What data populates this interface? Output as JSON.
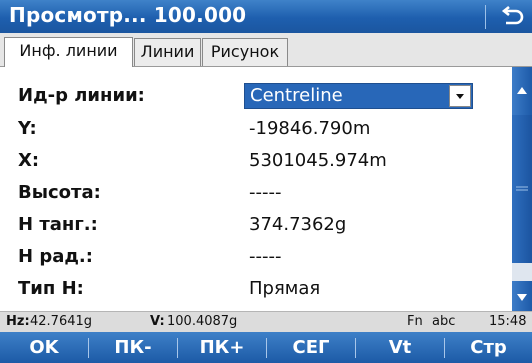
{
  "window": {
    "title": "Просмотр... 100.000",
    "back_icon": "back-arrow-icon"
  },
  "tabs": [
    {
      "label": "Инф. линии",
      "active": true
    },
    {
      "label": "Линии",
      "active": false
    },
    {
      "label": "Рисунок",
      "active": false
    }
  ],
  "fields": {
    "line_id": {
      "label": "Ид-р линии:",
      "value": "Centreline"
    },
    "y": {
      "label": "Y:",
      "value": "-19846.790m"
    },
    "x": {
      "label": "X:",
      "value": "5301045.974m"
    },
    "height": {
      "label": "Высота:",
      "value": "-----"
    },
    "h_tan": {
      "label": "H танг.:",
      "value": "374.7362g"
    },
    "h_rad": {
      "label": "H рад.:",
      "value": "-----"
    },
    "h_type": {
      "label": "Тип H:",
      "value": "Прямая"
    }
  },
  "status": {
    "hz_label": "Hz:",
    "hz_value": "42.7641g",
    "v_label": "V:",
    "v_value": "100.4087g",
    "fn": "Fn",
    "input_mode": "abc",
    "time": "15:48"
  },
  "softkeys": [
    "OK",
    "ПК-",
    "ПК+",
    "СЕГ",
    "Vt",
    "Стр"
  ],
  "colors": {
    "accent": "#1e5fae",
    "selection": "#2867b8"
  }
}
